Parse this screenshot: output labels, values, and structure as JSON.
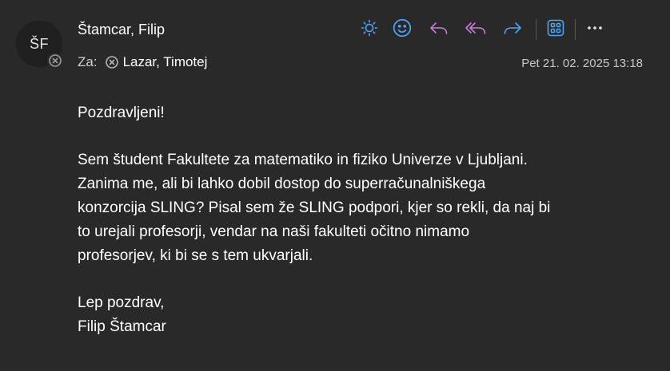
{
  "sender": {
    "initials": "ŠF",
    "name": "Štamcar, Filip"
  },
  "recipients": {
    "label": "Za:",
    "items": [
      {
        "name": "Lazar, Timotej"
      }
    ]
  },
  "date": "Pet 21. 02. 2025 13:18",
  "toolbar": {
    "icons": [
      "brightness-icon",
      "emoji-icon",
      "reply-icon",
      "reply-all-icon",
      "forward-icon",
      "apps-icon",
      "more-icon"
    ],
    "accent_color": "#4fa3f7",
    "reply_color": "#c77dd6"
  },
  "message": {
    "greeting": "Pozdravljeni!",
    "paragraph_lines": [
      "Sem študent Fakultete za matematiko in fiziko Univerze v Ljubljani.",
      "Zanima me, ali bi lahko dobil dostop do superračunalniškega",
      "konzorcija SLING? Pisal sem že SLING podpori, kjer so rekli, da naj bi",
      "to urejali profesorji, vendar na naši fakulteti očitno nimamo",
      "profesorjev, ki bi se s tem ukvarjali."
    ],
    "closing": "Lep pozdrav,",
    "signature": "Filip Štamcar"
  }
}
